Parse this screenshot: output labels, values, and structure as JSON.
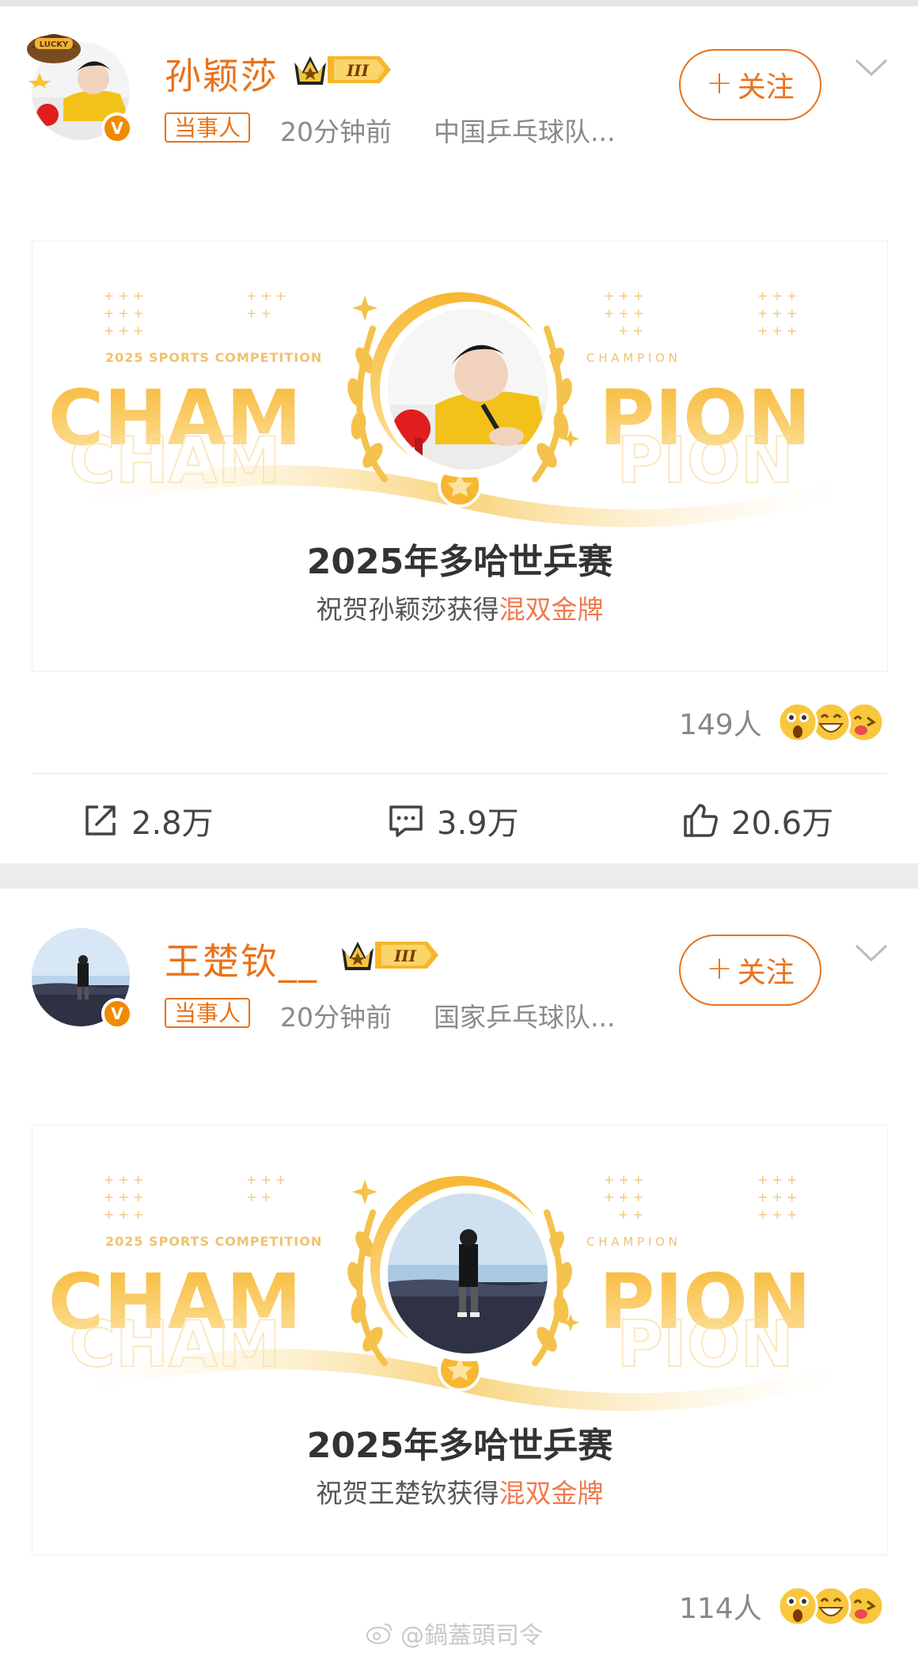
{
  "posts": [
    {
      "author": "孙颖莎",
      "crown_level": "III",
      "tag": "当事人",
      "time": "20分钟前",
      "source": "中国乒乓球队...",
      "follow_label": "关注",
      "follow_plus": "+",
      "card": {
        "kicker": "2025 SPORTS COMPETITION",
        "champion_small": "C H A M P I O N",
        "big_left": "CHAM",
        "big_right": "PION",
        "title": "2025年多哈世乒赛",
        "subtitle_prefix": "祝贺孙颖莎获得",
        "subtitle_highlight": "混双金牌"
      },
      "reactions": "149人",
      "actions": {
        "share": "2.8万",
        "comment": "3.9万",
        "like": "20.6万"
      }
    },
    {
      "author": "王楚钦__",
      "crown_level": "III",
      "tag": "当事人",
      "time": "20分钟前",
      "source": "国家乒乓球队...",
      "follow_label": "关注",
      "follow_plus": "+",
      "card": {
        "kicker": "2025 SPORTS COMPETITION",
        "champion_small": "C H A M P I O N",
        "big_left": "CHAM",
        "big_right": "PION",
        "title": "2025年多哈世乒赛",
        "subtitle_prefix": "祝贺王楚钦获得",
        "subtitle_highlight": "混双金牌"
      },
      "reactions": "114人"
    }
  ],
  "avatar_badge": "V",
  "lucky_text": "LUCKY",
  "watermark": "@鍋蓋頭司令",
  "colors": {
    "accent_orange": "#e8721a",
    "highlight_red": "#ee7a4e",
    "gold": "#f2b233",
    "muted_text": "#8a8a8a"
  }
}
